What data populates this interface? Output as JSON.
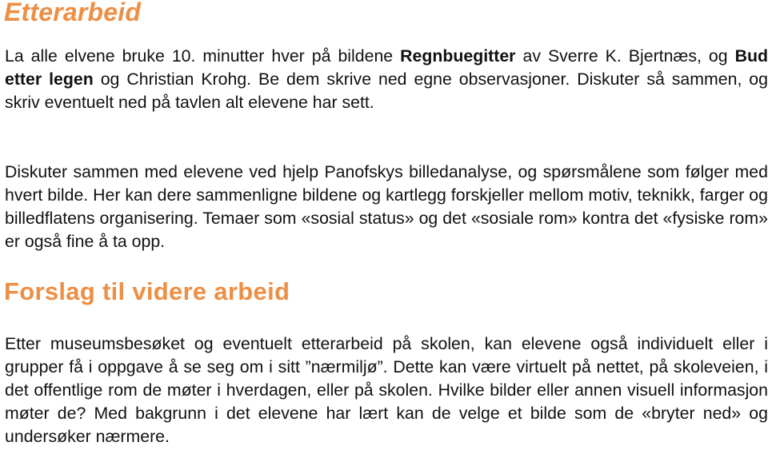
{
  "section1": {
    "heading": "Etterarbeid",
    "paragraph1": {
      "part1": "La alle elvene bruke 10. minutter hver på bildene ",
      "bold1": "Regnbuegitter",
      "part2": " av Sverre K. Bjertnæs, og ",
      "bold2": "Bud etter legen",
      "part3": " og Christian Krohg. Be dem skrive ned egne observasjoner. Diskuter så sammen, og skriv eventuelt ned på tavlen alt elevene har sett."
    },
    "paragraph2": "Diskuter sammen med elevene ved hjelp Panofskys billedanalyse, og spørsmålene som følger med hvert bilde. Her kan dere sammenligne bildene og kartlegg forskjeller mellom motiv, teknikk, farger og billedflatens organisering. Temaer som «sosial status» og det «sosiale rom» kontra det «fysiske rom» er også fine å ta opp."
  },
  "section2": {
    "heading": "Forslag til videre arbeid",
    "paragraph": "Etter museumsbesøket og eventuelt etterarbeid på skolen, kan elevene også individuelt eller i grupper få i oppgave å se seg om i sitt ”nærmiljø”. Dette kan være virtuelt på nettet, på skoleveien, i det offentlige rom de møter i hverdagen, eller på skolen. Hvilke bilder eller annen visuell informasjon møter de? Med bakgrunn i det elevene har lært kan de velge et bilde som de «bryter ned» og undersøker nærmere."
  },
  "colors": {
    "heading": "#ec8f45",
    "body_text": "#111111",
    "background": "#ffffff"
  }
}
